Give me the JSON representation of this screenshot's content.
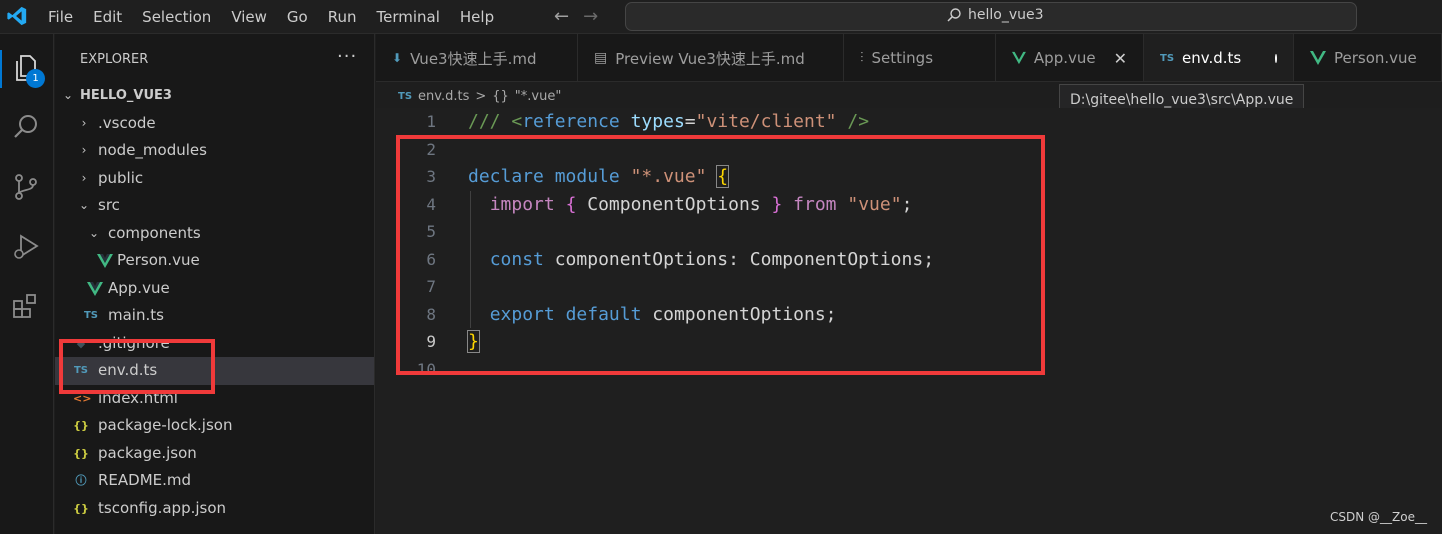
{
  "menu": [
    "File",
    "Edit",
    "Selection",
    "View",
    "Go",
    "Run",
    "Terminal",
    "Help"
  ],
  "command_center": {
    "text": "hello_vue3"
  },
  "activity": {
    "badge": "1"
  },
  "explorer": {
    "header": "EXPLORER",
    "more": "···",
    "root": "HELLO_VUE3",
    "items": [
      {
        "label": ".vscode",
        "type": "folder",
        "depth": 1,
        "expanded": false
      },
      {
        "label": "node_modules",
        "type": "folder",
        "depth": 1,
        "expanded": false
      },
      {
        "label": "public",
        "type": "folder",
        "depth": 1,
        "expanded": false
      },
      {
        "label": "src",
        "type": "folder",
        "depth": 1,
        "expanded": true
      },
      {
        "label": "components",
        "type": "folder",
        "depth": 2,
        "expanded": true
      },
      {
        "label": "Person.vue",
        "type": "vue",
        "depth": 3
      },
      {
        "label": "App.vue",
        "type": "vue",
        "depth": 2
      },
      {
        "label": "main.ts",
        "type": "ts",
        "depth": 2
      },
      {
        "label": ".gitignore",
        "type": "git",
        "depth": 1
      },
      {
        "label": "env.d.ts",
        "type": "ts",
        "depth": 1,
        "selected": true
      },
      {
        "label": "index.html",
        "type": "html",
        "depth": 1
      },
      {
        "label": "package-lock.json",
        "type": "json",
        "depth": 1
      },
      {
        "label": "package.json",
        "type": "json",
        "depth": 1
      },
      {
        "label": "README.md",
        "type": "info",
        "depth": 1
      },
      {
        "label": "tsconfig.app.json",
        "type": "json",
        "depth": 1
      }
    ]
  },
  "tabs": [
    {
      "label": "Vue3快速上手.md",
      "icon": "markdown-icon"
    },
    {
      "label": "Preview Vue3快速上手.md",
      "icon": "preview-icon"
    },
    {
      "label": "Settings",
      "icon": "settings-icon"
    },
    {
      "label": "App.vue",
      "icon": "vue-icon",
      "close": "✕"
    },
    {
      "label": "env.d.ts",
      "icon": "ts-icon",
      "active": true,
      "dirty": true
    },
    {
      "label": "Person.vue",
      "icon": "vue-icon"
    }
  ],
  "breadcrumb": {
    "file": "env.d.ts",
    "sep": ">",
    "symbol_icon": "{}",
    "symbol": "\"*.vue\""
  },
  "tooltip": "D:\\gitee\\hello_vue3\\src\\App.vue",
  "editor": {
    "line_numbers": [
      "1",
      "2",
      "3",
      "4",
      "5",
      "6",
      "7",
      "8",
      "9",
      "10"
    ],
    "current_line": "9",
    "lines": {
      "l1": {
        "comment": "/// ",
        "lt": "<",
        "tag": "reference",
        "attr": "types",
        "eq": "=",
        "val": "\"vite/client\"",
        "end": " />"
      },
      "l3": {
        "kw1": "declare",
        "kw2": "module",
        "str": "\"*.vue\"",
        "brace": "{"
      },
      "l4": {
        "kw": "import",
        "b1": "{",
        "name": "ComponentOptions",
        "b2": "}",
        "from": "from",
        "str": "\"vue\"",
        "semi": ";"
      },
      "l6": {
        "kw": "const",
        "name": "componentOptions",
        "colon": ": ",
        "type": "ComponentOptions",
        "semi": ";"
      },
      "l8": {
        "kw1": "export",
        "kw2": "default",
        "name": "componentOptions",
        "semi": ";"
      },
      "l9": {
        "brace": "}"
      }
    }
  },
  "watermark": "CSDN @__Zoe__",
  "colors": {
    "accent": "#0078d4",
    "annotation": "#f03a3a",
    "vue": "#41b883",
    "ts": "#519aba"
  }
}
